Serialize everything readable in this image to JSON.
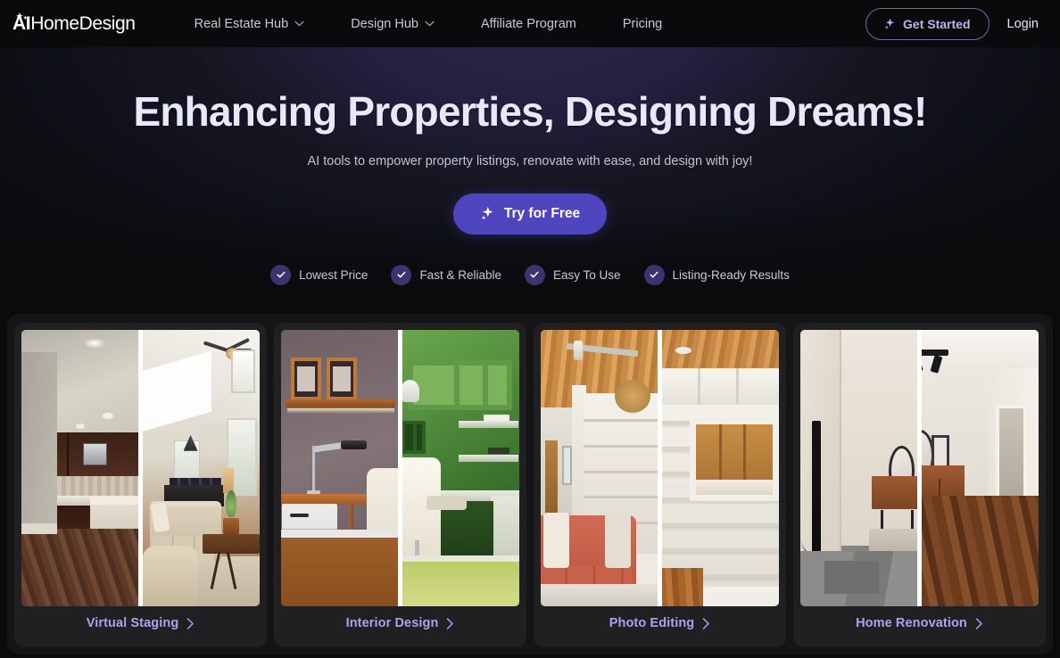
{
  "header": {
    "logo_text_bold": "AI",
    "logo_text_rest": "HomeDesign",
    "nav_items": [
      {
        "label": "Real Estate Hub",
        "has_dropdown": true
      },
      {
        "label": "Design Hub",
        "has_dropdown": true
      },
      {
        "label": "Affiliate Program",
        "has_dropdown": false
      },
      {
        "label": "Pricing",
        "has_dropdown": false
      }
    ],
    "get_started_label": "Get Started",
    "login_label": "Login"
  },
  "hero": {
    "headline": "Enhancing Properties, Designing Dreams!",
    "subheadline": "AI tools to empower property listings, renovate with ease, and design with joy!",
    "cta_label": "Try for Free",
    "badges": [
      {
        "label": "Lowest Price"
      },
      {
        "label": "Fast & Reliable"
      },
      {
        "label": "Easy To Use"
      },
      {
        "label": "Listing-Ready Results"
      }
    ]
  },
  "cards": [
    {
      "label": "Virtual Staging"
    },
    {
      "label": "Interior Design"
    },
    {
      "label": "Photo Editing"
    },
    {
      "label": "Home Renovation"
    }
  ],
  "colors": {
    "page_background": "#0b0b0d",
    "header_background": "#0a0a0c",
    "hero_glow": "#232040",
    "primary_button": "#4f46bf",
    "accent_lavender": "#a9a3ee",
    "badge_circle": "#3a3470",
    "card_background": "#202023",
    "cards_shell_background": "#151517",
    "headline_color": "#e9e7fb",
    "body_text": "#c3c2d2"
  },
  "icons": {
    "logo_sparkle": "sparkle-icon",
    "nav_chevron": "chevron-down-icon",
    "get_started_sparkle": "sparkle-icon",
    "cta_sparkle": "sparkle-icon",
    "badge_check": "check-icon",
    "card_arrow": "chevron-right-icon"
  }
}
